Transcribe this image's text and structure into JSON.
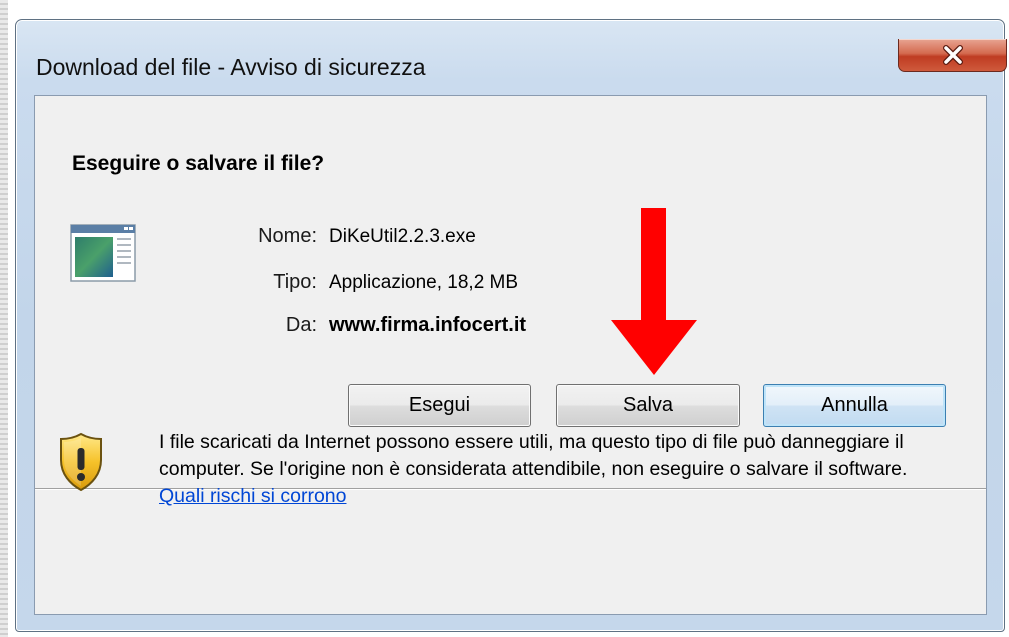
{
  "dialog": {
    "title": "Download del file - Avviso di sicurezza",
    "close_icon": "close-x-icon",
    "heading": "Eseguire o salvare il file?",
    "file_icon": "executable-file-icon",
    "fields": {
      "name_label": "Nome:",
      "name_value": "DiKeUtil2.2.3.exe",
      "type_label": "Tipo:",
      "type_value": "Applicazione, 18,2 MB",
      "from_label": "Da:",
      "from_value": "www.firma.infocert.it"
    },
    "buttons": {
      "run": "Esegui",
      "save": "Salva",
      "cancel": "Annulla"
    },
    "annotation": {
      "icon": "red-down-arrow",
      "color": "#ff0000"
    },
    "warning": {
      "icon": "security-shield-icon",
      "text": "I file scaricati da Internet possono essere utili, ma questo tipo di file può danneggiare il computer. Se l'origine non è considerata attendibile, non eseguire o salvare il software.",
      "link": "Quali rischi si corrono"
    }
  },
  "colors": {
    "frame": "#c5d7eb",
    "close_button": "#c7452a",
    "link": "#0046d5",
    "arrow": "#ff0000"
  }
}
